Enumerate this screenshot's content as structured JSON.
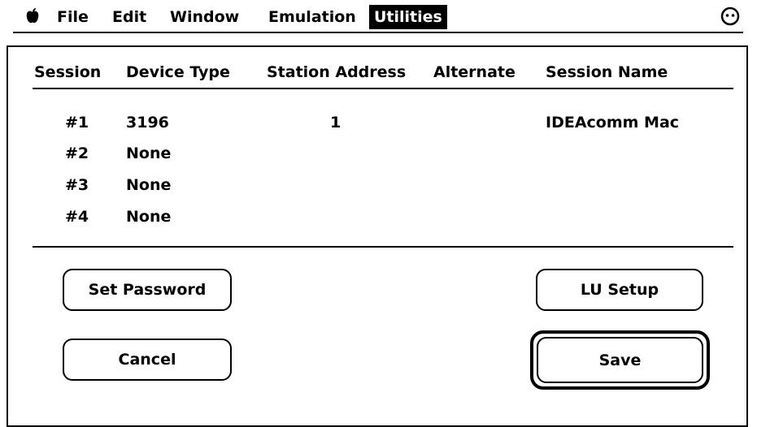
{
  "menubar": {
    "items": [
      {
        "label": "File"
      },
      {
        "label": "Edit"
      },
      {
        "label": "Window"
      },
      {
        "label": "Emulation"
      },
      {
        "label": "Utilities",
        "selected": true
      }
    ]
  },
  "table": {
    "headers": [
      "Session",
      "Device Type",
      "Station Address",
      "Alternate",
      "Session Name"
    ],
    "rows": [
      {
        "session": "#1",
        "device_type": "3196",
        "station_address": "1",
        "alternate": "",
        "session_name": "IDEAcomm Mac"
      },
      {
        "session": "#2",
        "device_type": "None",
        "station_address": "",
        "alternate": "",
        "session_name": ""
      },
      {
        "session": "#3",
        "device_type": "None",
        "station_address": "",
        "alternate": "",
        "session_name": ""
      },
      {
        "session": "#4",
        "device_type": "None",
        "station_address": "",
        "alternate": "",
        "session_name": ""
      }
    ]
  },
  "buttons": {
    "set_password": "Set Password",
    "lu_setup": "LU Setup",
    "cancel": "Cancel",
    "save": "Save"
  },
  "icons": {
    "apple": "apple-logo",
    "status": "smiley-face"
  }
}
